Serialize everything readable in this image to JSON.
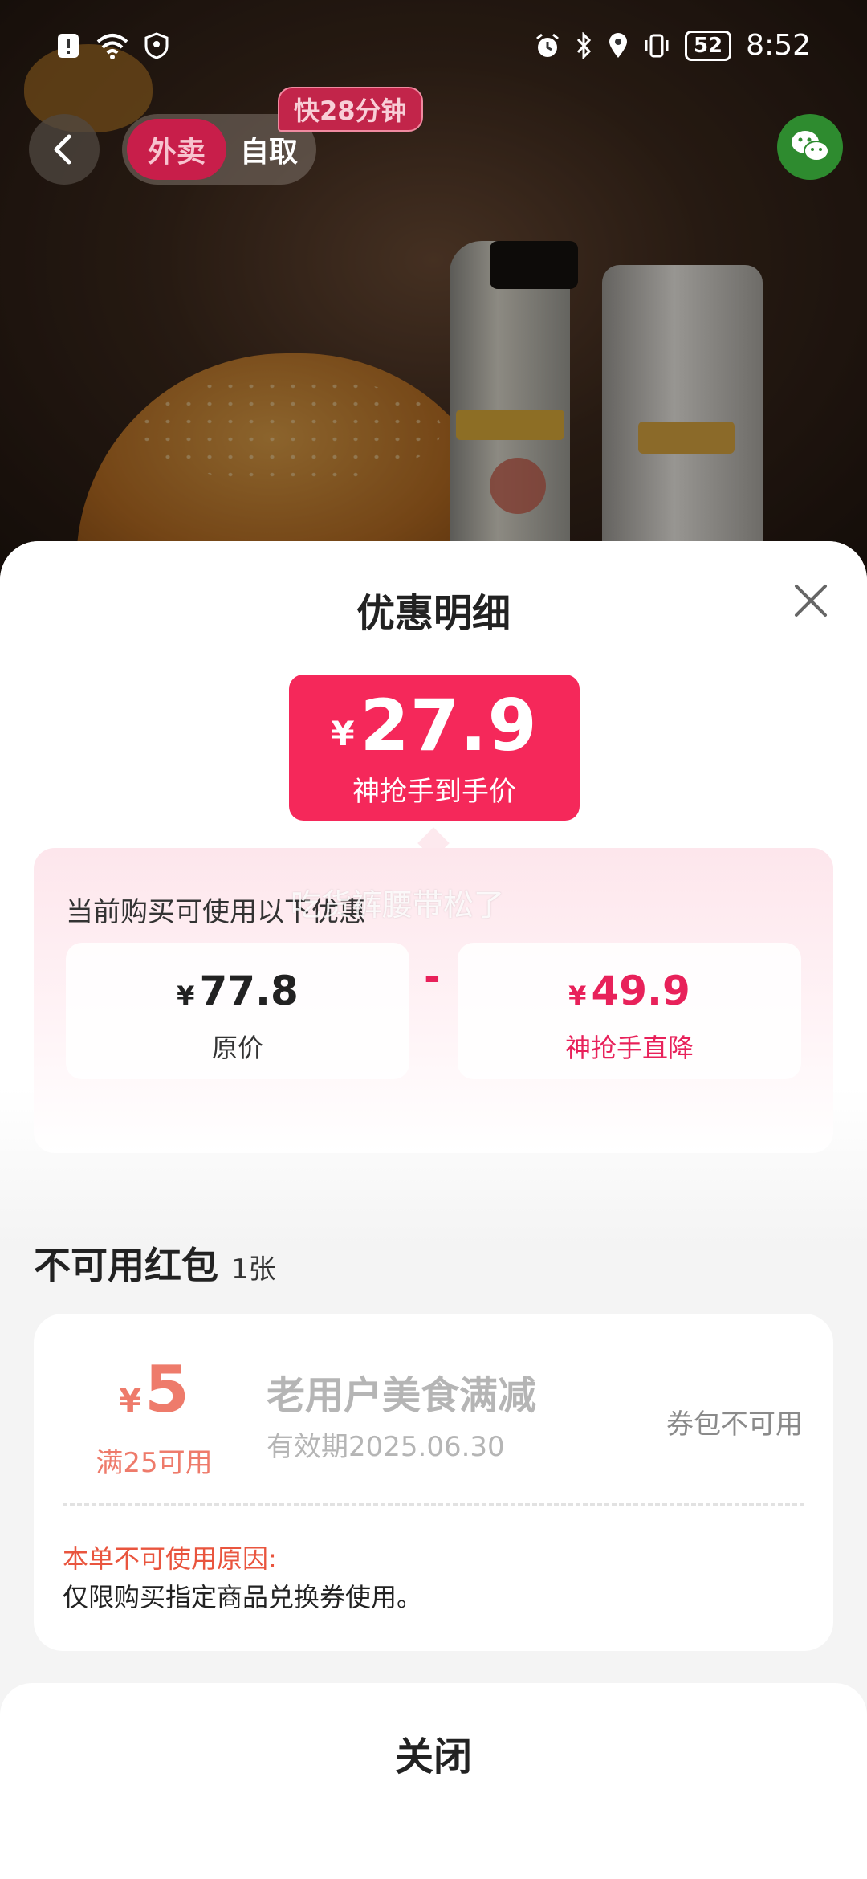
{
  "status_bar": {
    "time": "8:52",
    "battery": "52",
    "icons_left": [
      "notification-icon",
      "wifi-icon",
      "vpn-shield-icon"
    ],
    "icons_right": [
      "alarm-icon",
      "bluetooth-icon",
      "location-icon",
      "vibrate-icon",
      "battery-icon"
    ]
  },
  "header": {
    "mode_tabs": [
      {
        "label": "外卖",
        "selected": true
      },
      {
        "label": "自取",
        "selected": false
      }
    ],
    "eta_badge": "快28分钟",
    "share_icon": "wechat-icon"
  },
  "sheet": {
    "title": "优惠明细",
    "final_price": {
      "currency": "¥",
      "amount": "27.9",
      "label": "神抢手到手价"
    },
    "promo_hint": "当前购买可使用以下优惠",
    "watermark": "吃货裤腰带松了",
    "breakdown": {
      "original": {
        "currency": "¥",
        "amount": "77.8",
        "label": "原价"
      },
      "operator": "-",
      "discount": {
        "currency": "¥",
        "amount": "49.9",
        "label": "神抢手直降"
      }
    },
    "unavailable": {
      "heading": "不可用红包",
      "count": "1张",
      "coupons": [
        {
          "currency": "¥",
          "value": "5",
          "condition": "满25可用",
          "name": "老用户美食满减",
          "expiry": "有效期2025.06.30",
          "status": "券包不可用",
          "reason_title": "本单不可使用原因:",
          "reason": "仅限购买指定商品兑换券使用。"
        }
      ]
    },
    "close_label": "关闭"
  },
  "colors": {
    "accent": "#f5285a",
    "discount_text": "#e8215a",
    "coupon_value": "#ee7b6b",
    "reason_title": "#e9553e",
    "mode_selected": "#c81e4a",
    "wechat": "#2e8b2f"
  }
}
